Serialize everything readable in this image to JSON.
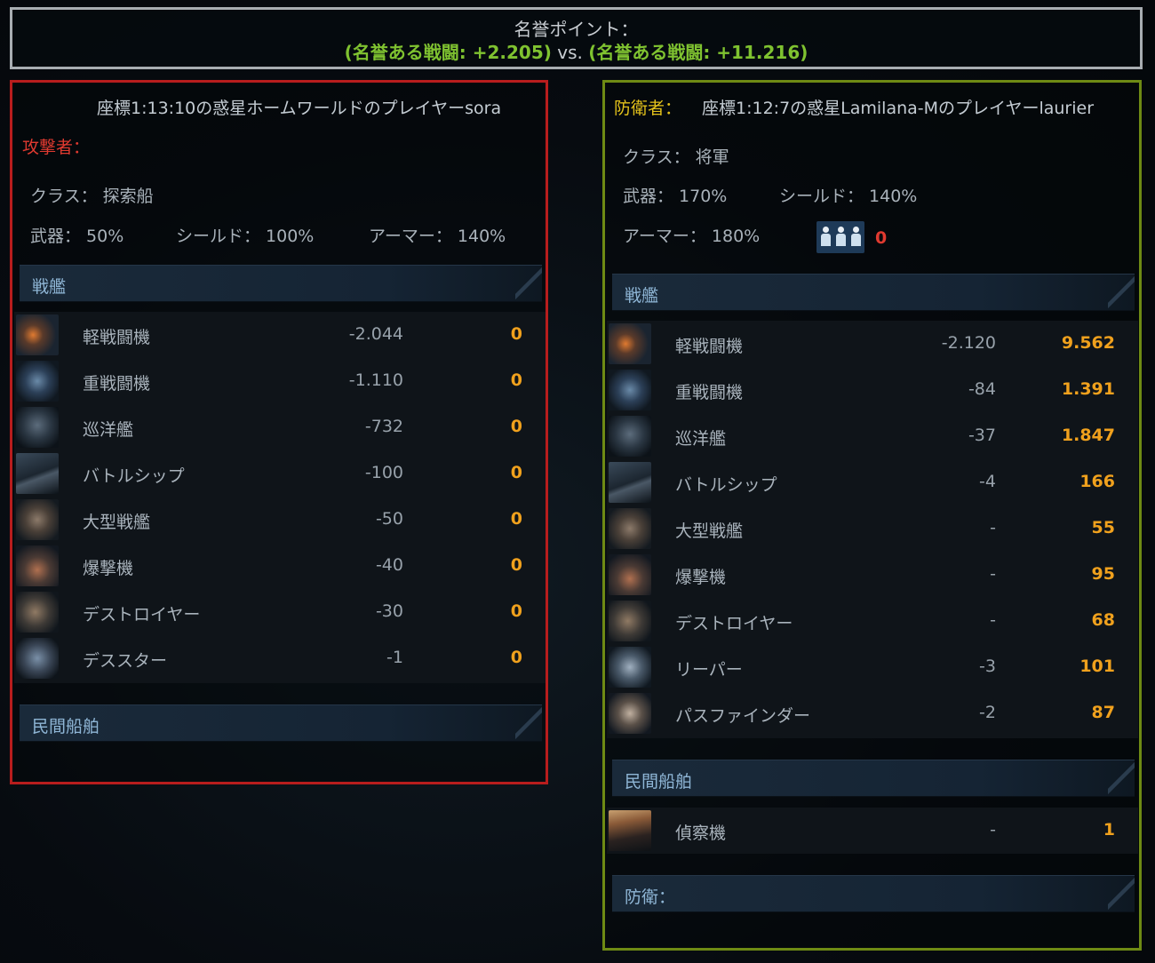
{
  "honor": {
    "title": "名誉ポイント：",
    "attacker_text": "(名誉ある戦闘: +2.205)",
    "vs": " vs. ",
    "defender_text": "(名誉ある戦闘: +11.216)"
  },
  "attacker": {
    "coord": "座標1:13:10の惑星ホームワールドのプレイヤーsora",
    "role": "攻撃者：",
    "class": "クラス：  探索船",
    "weapon": "武器：  50%",
    "shield": "シールド：  100%",
    "armor": "アーマー：  140%",
    "ships_title": "戦艦",
    "ships": [
      {
        "name": "軽戦闘機",
        "loss": "-2.044",
        "remain": "0",
        "icon": "light-fighter"
      },
      {
        "name": "重戦闘機",
        "loss": "-1.110",
        "remain": "0",
        "icon": "heavy-fighter"
      },
      {
        "name": "巡洋艦",
        "loss": "-732",
        "remain": "0",
        "icon": "cruiser"
      },
      {
        "name": "バトルシップ",
        "loss": "-100",
        "remain": "0",
        "icon": "battleship"
      },
      {
        "name": "大型戦艦",
        "loss": "-50",
        "remain": "0",
        "icon": "battlecruiser"
      },
      {
        "name": "爆撃機",
        "loss": "-40",
        "remain": "0",
        "icon": "bomber"
      },
      {
        "name": "デストロイヤー",
        "loss": "-30",
        "remain": "0",
        "icon": "destroyer"
      },
      {
        "name": "デススター",
        "loss": "-1",
        "remain": "0",
        "icon": "deathstar"
      }
    ],
    "civil_title": "民間船舶"
  },
  "defender": {
    "role": "防衛者：",
    "coord": "座標1:12:7の惑星Lamilana-Mのプレイヤーlaurier",
    "class": "クラス：  将軍",
    "weapon": "武器：  170%",
    "shield": "シールド：  140%",
    "armor": "アーマー：  180%",
    "crew_count": "0",
    "ships_title": "戦艦",
    "ships": [
      {
        "name": "軽戦闘機",
        "loss": "-2.120",
        "remain": "9.562",
        "icon": "light-fighter"
      },
      {
        "name": "重戦闘機",
        "loss": "-84",
        "remain": "1.391",
        "icon": "heavy-fighter"
      },
      {
        "name": "巡洋艦",
        "loss": "-37",
        "remain": "1.847",
        "icon": "cruiser"
      },
      {
        "name": "バトルシップ",
        "loss": "-4",
        "remain": "166",
        "icon": "battleship"
      },
      {
        "name": "大型戦艦",
        "loss": "-",
        "remain": "55",
        "icon": "battlecruiser"
      },
      {
        "name": "爆撃機",
        "loss": "-",
        "remain": "95",
        "icon": "bomber"
      },
      {
        "name": "デストロイヤー",
        "loss": "-",
        "remain": "68",
        "icon": "destroyer"
      },
      {
        "name": "リーパー",
        "loss": "-3",
        "remain": "101",
        "icon": "reaper"
      },
      {
        "name": "パスファインダー",
        "loss": "-2",
        "remain": "87",
        "icon": "pathfinder"
      }
    ],
    "civil_title": "民間船舶",
    "civil": [
      {
        "name": "偵察機",
        "loss": "-",
        "remain": "1",
        "icon": "espionage-probe"
      }
    ],
    "defense_title": "防衛："
  },
  "colors": {
    "attacker_border": "#b81d1d",
    "defender_border": "#6e8a14",
    "honor_green": "#7fc230",
    "remain_orange": "#f0a11d",
    "role_red": "#e03a30",
    "role_yellow": "#e3c11b"
  }
}
